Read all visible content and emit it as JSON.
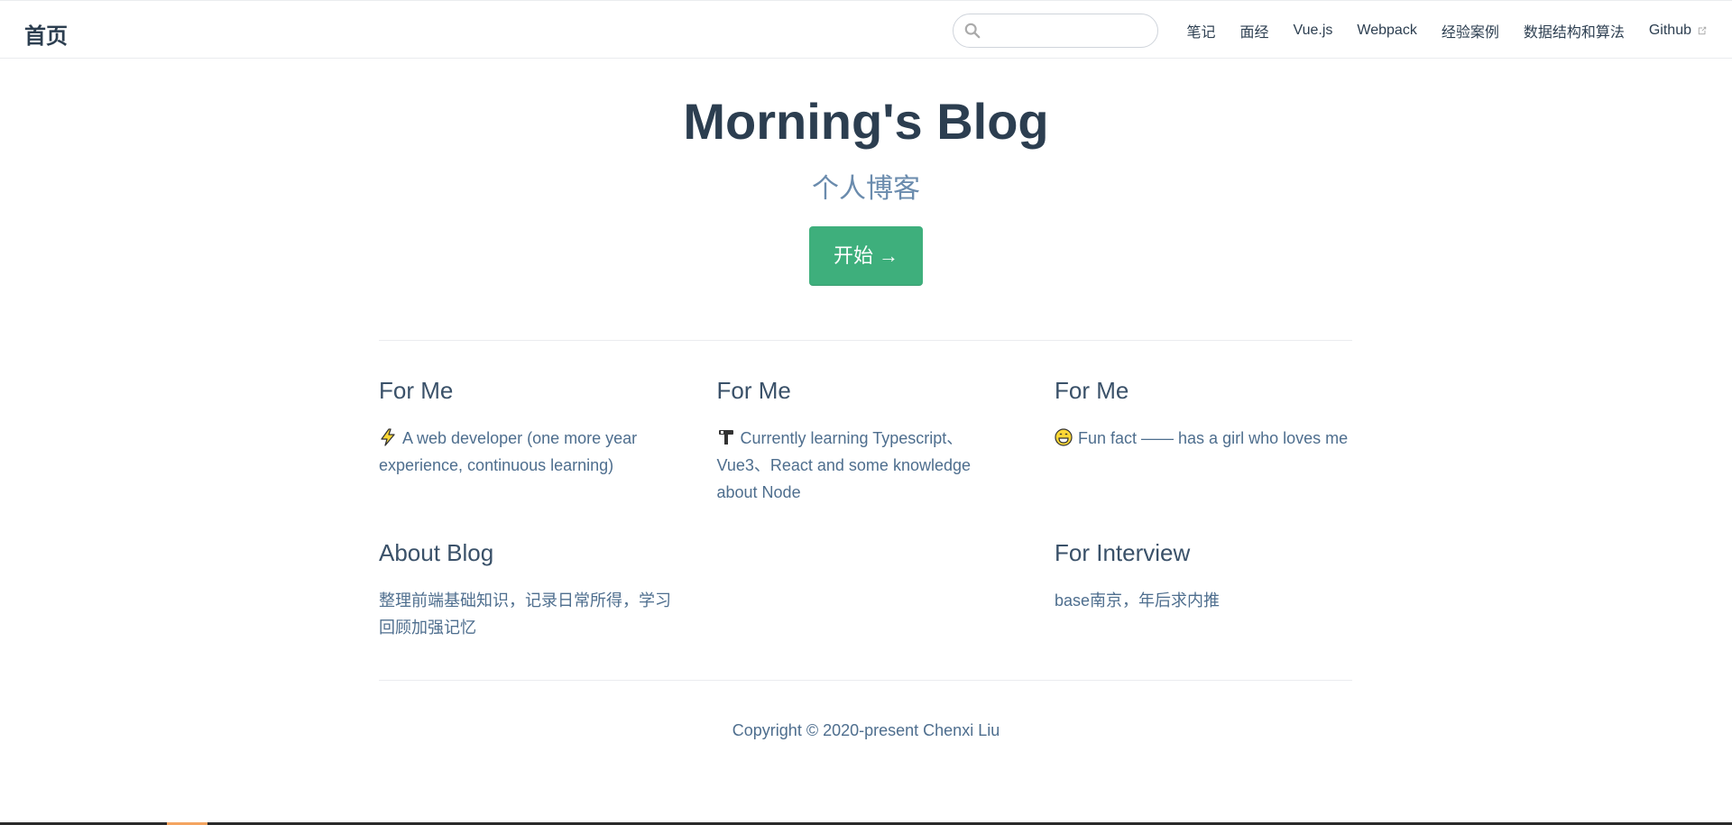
{
  "navbar": {
    "site_name": "首页",
    "search": {
      "value": "",
      "placeholder": "",
      "icon": "search-icon"
    },
    "links": [
      {
        "label": "笔记"
      },
      {
        "label": "面经"
      },
      {
        "label": "Vue.js"
      },
      {
        "label": "Webpack"
      },
      {
        "label": "经验案例"
      },
      {
        "label": "数据结构和算法"
      },
      {
        "label": "Github",
        "icon": "external-link-icon"
      }
    ]
  },
  "hero": {
    "title": "Morning's Blog",
    "description": "个人博客",
    "action_label": "开始 →"
  },
  "features": [
    {
      "title": "For Me",
      "emoji": "lightning-icon",
      "details": "A web developer (one more year experience, continuous learning)"
    },
    {
      "title": "For Me",
      "emoji": "hammer-icon",
      "details": "Currently learning Typescript、Vue3、React and some knowledge about Node"
    },
    {
      "title": "For Me",
      "emoji": "grin-face-icon",
      "details": "Fun fact —— has a girl who loves me"
    },
    {
      "title": "About Blog",
      "details": "整理前端基础知识，记录日常所得，学习回顾加强记忆"
    },
    {
      "title": "For Interview",
      "details": "base南京，年后求内推"
    }
  ],
  "footer": {
    "copyright": "Copyright © 2020-present Chenxi Liu"
  },
  "colors": {
    "accent": "#3eaf7c",
    "text": "#2c3e50",
    "muted": "#4e6e8e",
    "description": "#6a8bad",
    "border": "#eaecef"
  }
}
